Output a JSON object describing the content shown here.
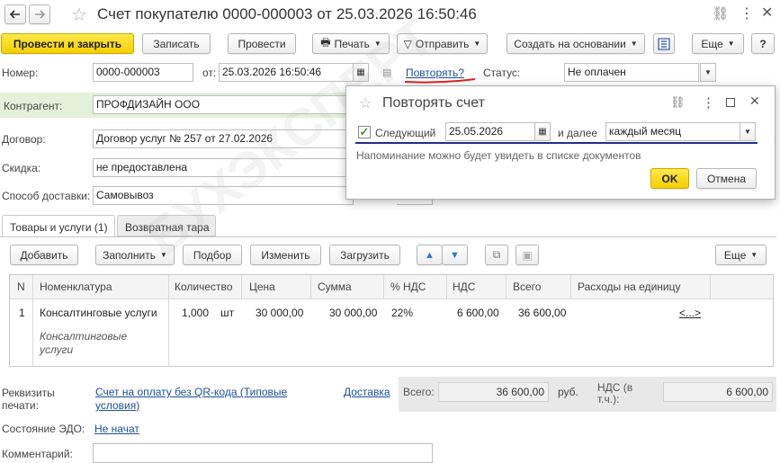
{
  "window": {
    "title": "Счет покупателю 0000-000003 от 25.03.2026 16:50:46"
  },
  "toolbar": {
    "post_and_close": "Провести и закрыть",
    "save": "Записать",
    "post": "Провести",
    "print": "Печать",
    "send": "Отправить",
    "create_based_on": "Создать на основании",
    "more": "Еще",
    "help": "?"
  },
  "form": {
    "number_label": "Номер:",
    "number_value": "0000-000003",
    "date_label": "от:",
    "date_value": "25.03.2026 16:50:46",
    "repeat_link": "Повторять?",
    "status_label": "Статус:",
    "status_value": "Не оплачен",
    "counterparty_label": "Контрагент:",
    "counterparty_value": "ПРОФДИЗАЙН ООО",
    "contract_label": "Договор:",
    "contract_value": "Договор услуг № 257 от 27.02.2026",
    "discount_label": "Скидка:",
    "discount_value": "не предоставлена",
    "delivery_label": "Способ доставки:",
    "delivery_value": "Самовывоз"
  },
  "tabs": [
    {
      "label": "Товары и услуги (1)"
    },
    {
      "label": "Возвратная тара"
    }
  ],
  "table_toolbar": {
    "add": "Добавить",
    "fill": "Заполнить",
    "select": "Подбор",
    "change": "Изменить",
    "load": "Загрузить",
    "more": "Еще"
  },
  "table": {
    "columns": [
      "N",
      "Номенклатура",
      "Количество",
      "Цена",
      "Сумма",
      "% НДС",
      "НДС",
      "Всего",
      "Расходы на единицу"
    ],
    "rows": [
      {
        "n": "1",
        "item": "Консалтинговые услуги",
        "item_sub": "Консалтинговые услуги",
        "qty": "1,000",
        "unit": "шт",
        "price": "30 000,00",
        "sum": "30 000,00",
        "vat_rate": "22%",
        "vat": "6 600,00",
        "total": "36 600,00",
        "expenses_link": "<...>"
      }
    ]
  },
  "footer": {
    "print_details_label": "Реквизиты печати:",
    "print_details_link": "Счет на оплату без QR-кода (Типовые условия)",
    "delivery_link": "Доставка",
    "total_label": "Всего:",
    "total_value": "36 600,00",
    "currency": "руб.",
    "vat_label": "НДС (в т.ч.):",
    "vat_value": "6 600,00",
    "edo_label": "Состояние ЭДО:",
    "edo_link": "Не начат",
    "comment_label": "Комментарий:",
    "comment_value": ""
  },
  "popup": {
    "title": "Повторять счет",
    "next_label": "Следующий",
    "next_checked": true,
    "next_date": "25.05.2026",
    "and_then_label": "и далее",
    "period_value": "каждый месяц",
    "hint": "Напоминание можно будет увидеть в списке документов",
    "ok": "OK",
    "cancel": "Отмена"
  },
  "watermark": "БУХЭКСПЕРТ"
}
